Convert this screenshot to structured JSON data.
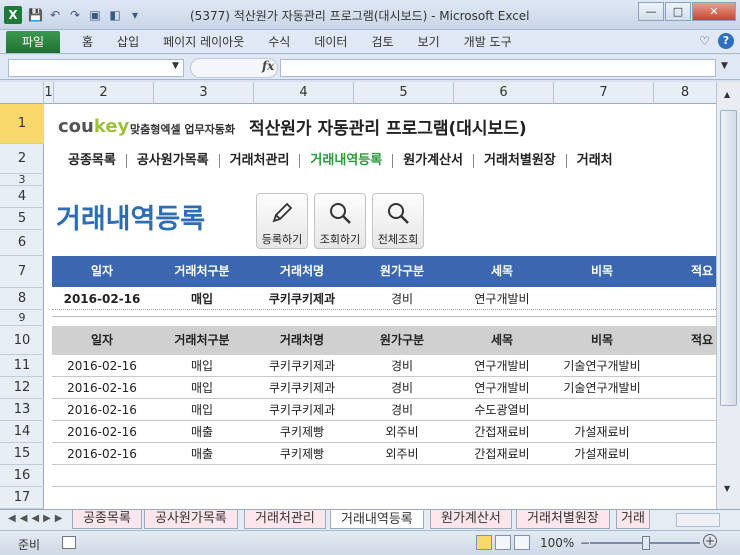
{
  "window": {
    "title": "(5377) 적산원가 자동관리 프로그램(대시보드) - Microsoft Excel",
    "app_icon": "X"
  },
  "ribbon": {
    "file_tab": "파일",
    "tabs": [
      "홈",
      "삽입",
      "페이지 레이아웃",
      "수식",
      "데이터",
      "검토",
      "보기",
      "개발 도구"
    ]
  },
  "formula_bar": {
    "fx": "fx",
    "name_box": "",
    "content": ""
  },
  "columns": [
    "1",
    "2",
    "3",
    "4",
    "5",
    "6",
    "7",
    "8"
  ],
  "rows": [
    "1",
    "2",
    "3",
    "4",
    "5",
    "6",
    "7",
    "8",
    "9",
    "10",
    "11",
    "12",
    "13",
    "14",
    "15",
    "16",
    "17"
  ],
  "sheet": {
    "logo_main": "cou",
    "logo_accent": "key",
    "logo_sub": "맞춤형엑셀 업무자동화",
    "app_title": "적산원가 자동관리 프로그램(대시보드)",
    "nav": [
      "공종목록",
      "공사원가목록",
      "거래처관리",
      "거래내역등록",
      "원가계산서",
      "거래처별원장",
      "거래처"
    ],
    "page_title": "거래내역등록",
    "buttons": {
      "register": "등록하기",
      "search": "조회하기",
      "search_all": "전체조회"
    },
    "headers": [
      "일자",
      "거래처구분",
      "거래처명",
      "원가구분",
      "세목",
      "비목",
      "적요"
    ],
    "input_row": [
      "2016-02-16",
      "매입",
      "쿠키쿠키제과",
      "경비",
      "연구개발비",
      "",
      ""
    ],
    "list_rows": [
      [
        "2016-02-16",
        "매입",
        "쿠키쿠키제과",
        "경비",
        "연구개발비",
        "기술연구개발비",
        ""
      ],
      [
        "2016-02-16",
        "매입",
        "쿠키쿠키제과",
        "경비",
        "연구개발비",
        "기술연구개발비",
        ""
      ],
      [
        "2016-02-16",
        "매입",
        "쿠키쿠키제과",
        "경비",
        "수도광열비",
        "",
        ""
      ],
      [
        "2016-02-16",
        "매출",
        "쿠키제빵",
        "외주비",
        "간접재료비",
        "가설재료비",
        ""
      ],
      [
        "2016-02-16",
        "매출",
        "쿠키제빵",
        "외주비",
        "간접재료비",
        "가설재료비",
        ""
      ]
    ]
  },
  "sheet_tabs": [
    "공종목록",
    "공사원가목록",
    "거래처관리",
    "거래내역등록",
    "원가계산서",
    "거래처별원장",
    "거래"
  ],
  "active_sheet_tab": "거래내역등록",
  "status_bar": {
    "ready": "준비",
    "zoom": "100%",
    "zoom_minus": "−",
    "zoom_plus": "+"
  }
}
